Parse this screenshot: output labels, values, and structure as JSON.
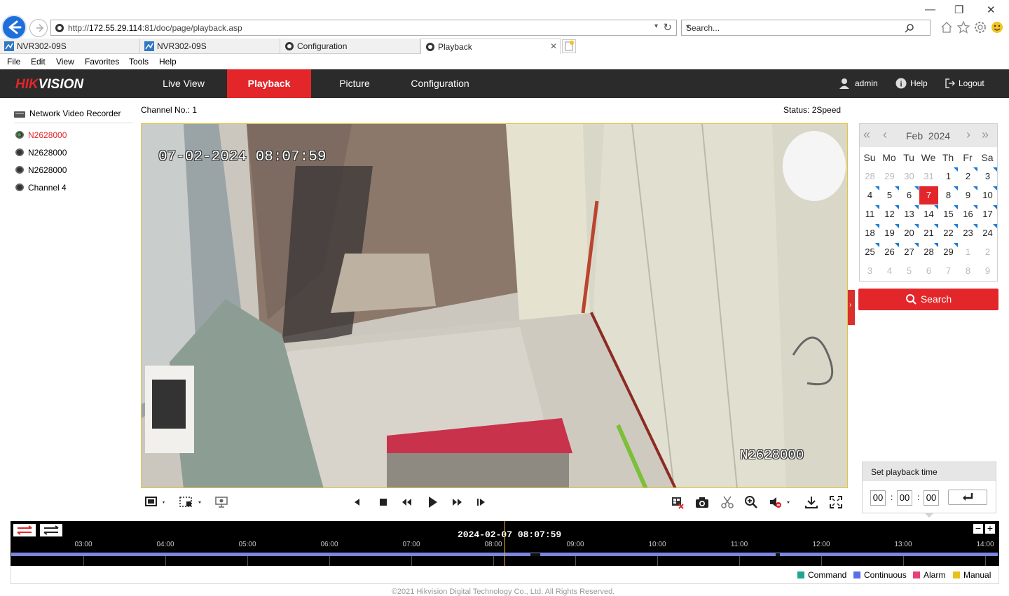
{
  "browser": {
    "url_prefix": "http://",
    "url_host": "172.55.29.114",
    "url_rest": ":81/doc/page/playback.asp",
    "search_placeholder": "Search...",
    "tabs": [
      {
        "label": "NVR302-09S"
      },
      {
        "label": "NVR302-09S"
      },
      {
        "label": "Configuration"
      },
      {
        "label": "Playback"
      }
    ],
    "menu": [
      "File",
      "Edit",
      "View",
      "Favorites",
      "Tools",
      "Help"
    ],
    "window_controls": {
      "minimize": "—",
      "restore": "❐",
      "close": "✕"
    }
  },
  "app": {
    "logo_hik": "HIK",
    "logo_vision": "VISION",
    "nav": [
      "Live View",
      "Playback",
      "Picture",
      "Configuration"
    ],
    "active_nav": "Playback",
    "user": "admin",
    "help": "Help",
    "logout": "Logout"
  },
  "tree": {
    "root": "Network Video Recorder",
    "channels": [
      {
        "label": "N2628000",
        "active": true
      },
      {
        "label": "N2628000",
        "active": false
      },
      {
        "label": "N2628000",
        "active": false
      },
      {
        "label": "Channel 4",
        "active": false
      }
    ]
  },
  "player": {
    "channel_label": "Channel No.: 1",
    "status_label": "Status: 2Speed",
    "osd_time": "07-02-2024 08:07:59",
    "osd_name": "N2628000"
  },
  "calendar": {
    "month": "Feb",
    "year": "2024",
    "weekdays": [
      "Su",
      "Mo",
      "Tu",
      "We",
      "Th",
      "Fr",
      "Sa"
    ],
    "days": [
      {
        "d": "28",
        "dim": true
      },
      {
        "d": "29",
        "dim": true
      },
      {
        "d": "30",
        "dim": true
      },
      {
        "d": "31",
        "dim": true
      },
      {
        "d": "1",
        "mark": true
      },
      {
        "d": "2",
        "mark": true
      },
      {
        "d": "3",
        "mark": true
      },
      {
        "d": "4",
        "mark": true
      },
      {
        "d": "5",
        "mark": true
      },
      {
        "d": "6",
        "mark": true
      },
      {
        "d": "7",
        "sel": true
      },
      {
        "d": "8",
        "mark": true
      },
      {
        "d": "9",
        "mark": true
      },
      {
        "d": "10",
        "mark": true
      },
      {
        "d": "11",
        "mark": true
      },
      {
        "d": "12",
        "mark": true
      },
      {
        "d": "13",
        "mark": true
      },
      {
        "d": "14",
        "mark": true
      },
      {
        "d": "15",
        "mark": true
      },
      {
        "d": "16",
        "mark": true
      },
      {
        "d": "17",
        "mark": true
      },
      {
        "d": "18",
        "mark": true
      },
      {
        "d": "19",
        "mark": true
      },
      {
        "d": "20",
        "mark": true
      },
      {
        "d": "21",
        "mark": true
      },
      {
        "d": "22",
        "mark": true
      },
      {
        "d": "23",
        "mark": true
      },
      {
        "d": "24",
        "mark": true
      },
      {
        "d": "25",
        "mark": true
      },
      {
        "d": "26",
        "mark": true
      },
      {
        "d": "27",
        "mark": true
      },
      {
        "d": "28",
        "mark": true
      },
      {
        "d": "29",
        "mark": true
      },
      {
        "d": "1",
        "dim": true
      },
      {
        "d": "2",
        "dim": true
      },
      {
        "d": "3",
        "dim": true
      },
      {
        "d": "4",
        "dim": true
      },
      {
        "d": "5",
        "dim": true
      },
      {
        "d": "6",
        "dim": true
      },
      {
        "d": "7",
        "dim": true
      },
      {
        "d": "8",
        "dim": true
      },
      {
        "d": "9",
        "dim": true
      }
    ],
    "search_label": "Search"
  },
  "playback_time": {
    "title": "Set playback time",
    "hh": "00",
    "mm": "00",
    "ss": "00",
    "sep": ":"
  },
  "timeline": {
    "current": "2024-02-07 08:07:59",
    "ticks": [
      "03:00",
      "04:00",
      "05:00",
      "06:00",
      "07:00",
      "08:00",
      "09:00",
      "10:00",
      "11:00",
      "12:00",
      "13:00",
      "14:00"
    ],
    "zoom_out": "−",
    "zoom_in": "+"
  },
  "legend": [
    {
      "label": "Command",
      "color": "#1fa58f"
    },
    {
      "label": "Continuous",
      "color": "#5a6ee8"
    },
    {
      "label": "Alarm",
      "color": "#e8407a"
    },
    {
      "label": "Manual",
      "color": "#e8c21a"
    }
  ],
  "footer": "©2021 Hikvision Digital Technology Co., Ltd. All Rights Reserved."
}
